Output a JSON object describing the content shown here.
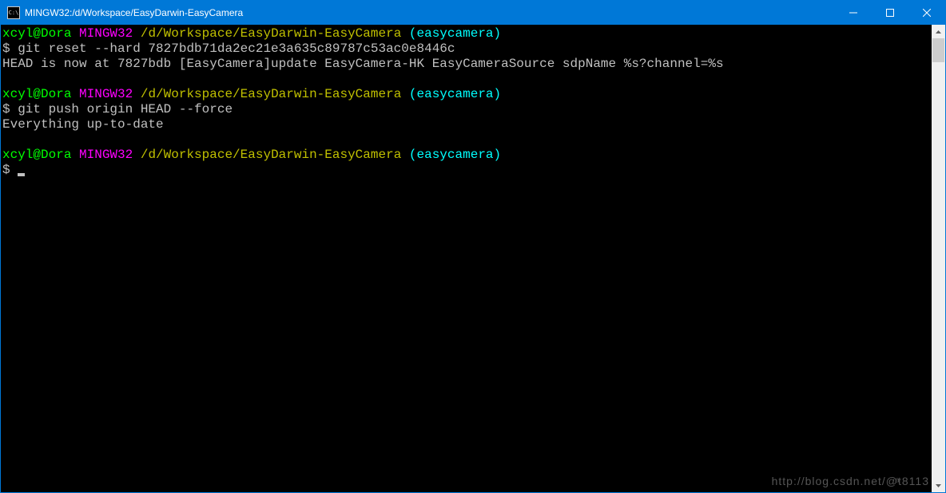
{
  "titlebar": {
    "icon_text": "C:\\",
    "title": "MINGW32:/d/Workspace/EasyDarwin-EasyCamera"
  },
  "prompt": {
    "user": "xcyl@Dora",
    "sys": " MINGW32",
    "path": " /d/Workspace/EasyDarwin-EasyCamera",
    "branch": " (easycamera)"
  },
  "blocks": [
    {
      "cmd": "$ git reset --hard 7827bdb71da2ec21e3a635c89787c53ac0e8446c",
      "out": "HEAD is now at 7827bdb [EasyCamera]update EasyCamera-HK EasyCameraSource sdpName %s?channel=%s"
    },
    {
      "cmd": "$ git push origin HEAD --force",
      "out": "Everything up-to-date"
    }
  ],
  "current_prompt": "$ ",
  "watermark": "http://blog.csdn.net/@ͣt8113"
}
